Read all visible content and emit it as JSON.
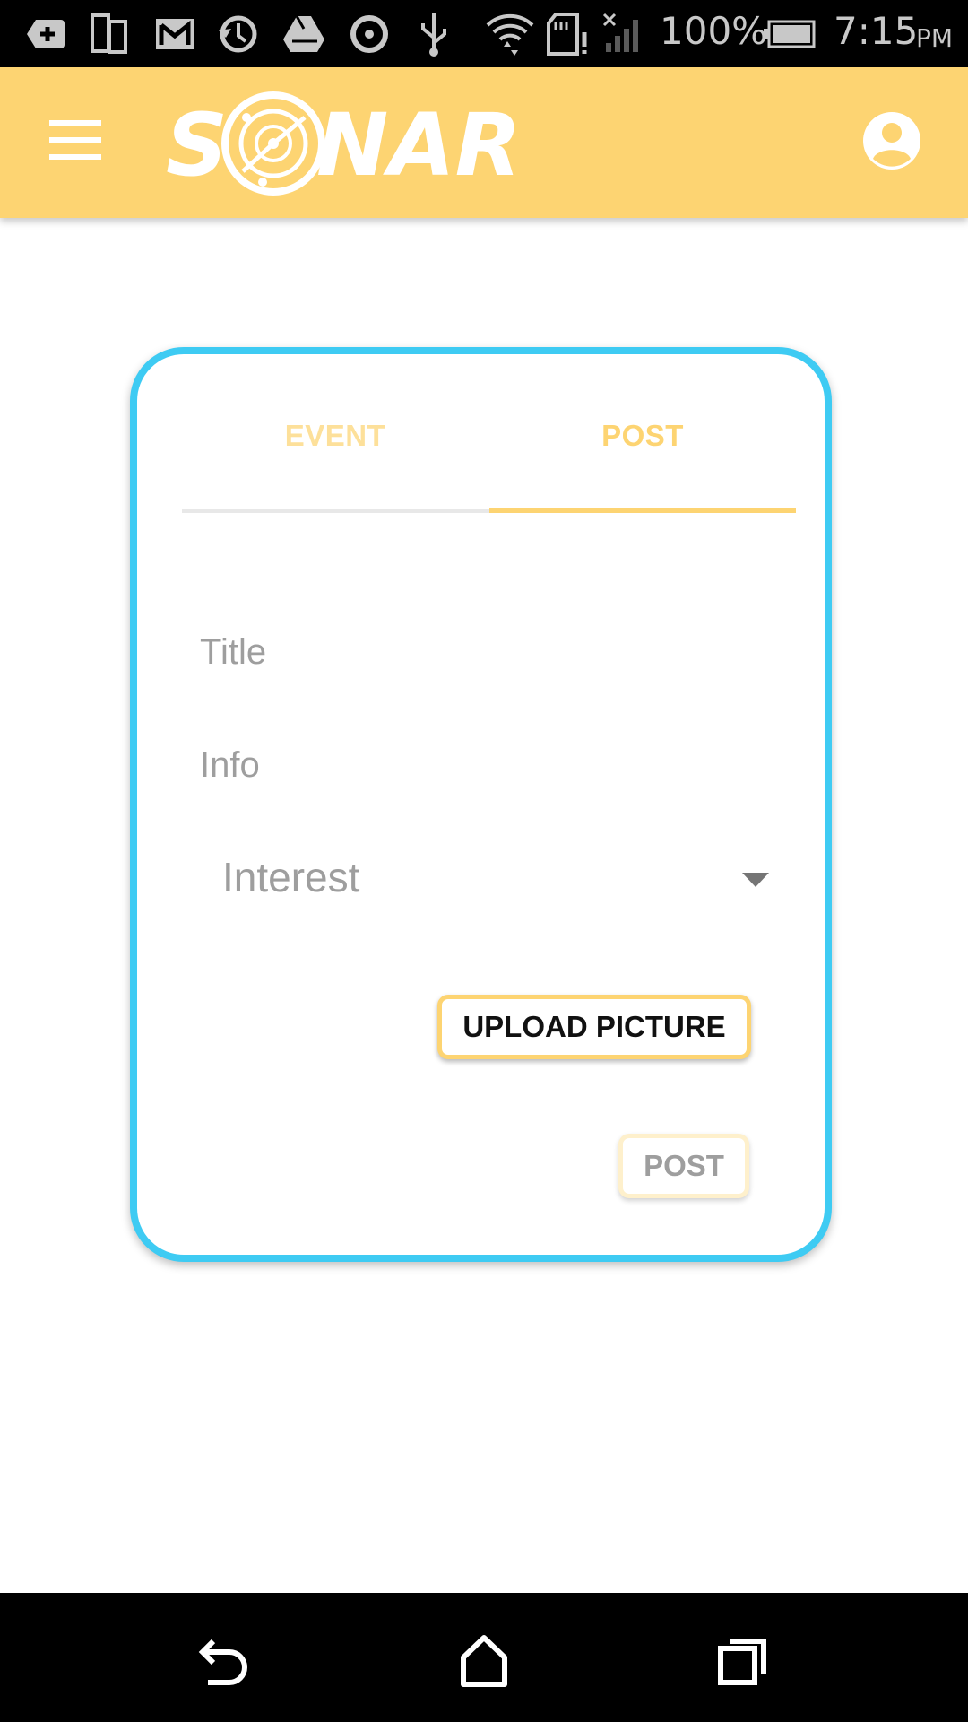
{
  "status_bar": {
    "icons": [
      "upload-icon",
      "phone-tablet-icon",
      "gmail-icon",
      "sync-icon",
      "drive-icon",
      "circle-refresh-icon",
      "usb-icon",
      "wifi-icon",
      "sd-card-alert-icon",
      "signal-icon",
      "battery-icon"
    ],
    "battery": "100%",
    "time": "7:15",
    "ampm": "PM"
  },
  "app_bar": {
    "logo_text": "SONAR",
    "icons": [
      "menu-icon",
      "account-circle-icon"
    ]
  },
  "tabs": [
    {
      "label": "EVENT",
      "active": false
    },
    {
      "label": "POST",
      "active": true
    }
  ],
  "form": {
    "title_placeholder": "Title",
    "info_placeholder": "Info",
    "interest_value": "Interest",
    "upload_label": "UPLOAD PICTURE",
    "post_label": "POST"
  },
  "nav_bar": {
    "icons": [
      "back-icon",
      "home-icon",
      "recents-icon"
    ]
  },
  "colors": {
    "accent": "#fdd472",
    "card_border": "#3ecbf3"
  }
}
